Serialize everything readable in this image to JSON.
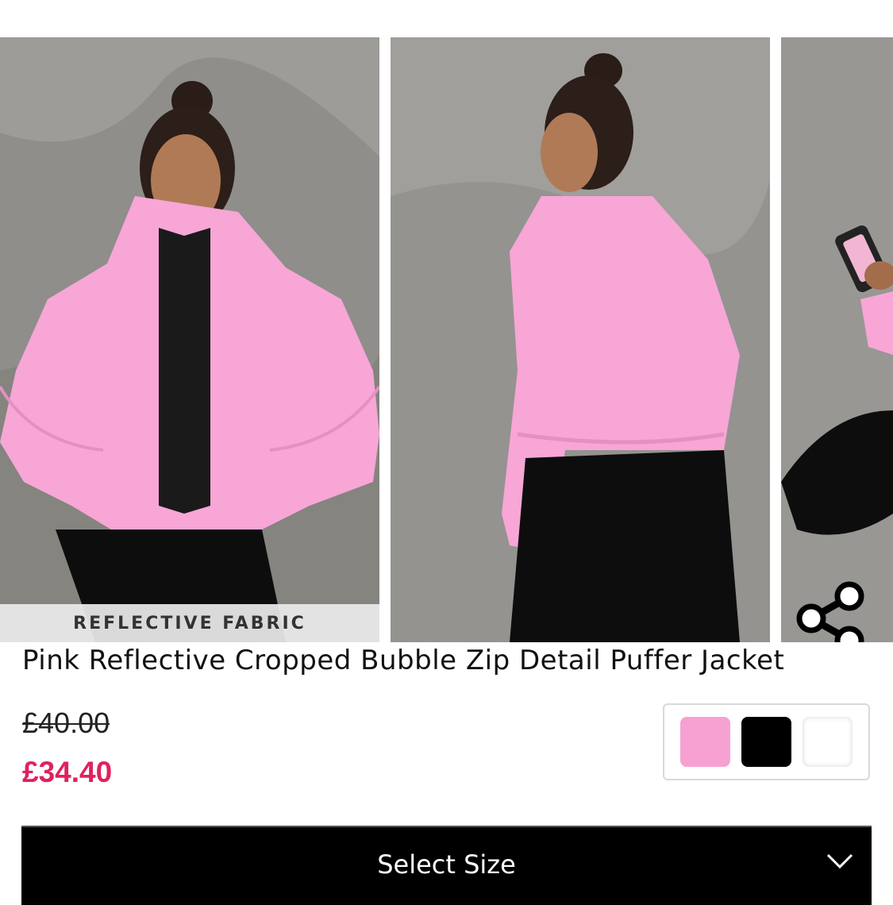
{
  "gallery": {
    "feature_label": "REFLECTIVE FABRIC"
  },
  "product": {
    "title": "Pink Reflective Cropped Bubble Zip Detail Puffer Jacket",
    "price_original": "£40.00",
    "price_sale": "£34.40"
  },
  "colors": {
    "accent_price": "#e0215e",
    "swatches": [
      "#f7a1d3",
      "#000000",
      "#ffffff"
    ]
  },
  "size_selector": {
    "label": "Select Size",
    "icon": "chevron-down-icon"
  },
  "icons": {
    "share": "share-icon"
  }
}
